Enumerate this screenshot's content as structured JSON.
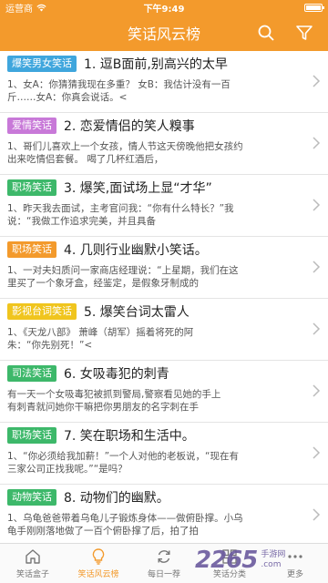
{
  "status": {
    "carrier": "运营商",
    "time": "下午9:49"
  },
  "header": {
    "title": "笑话风云榜"
  },
  "colors": {
    "accent": "#f39a2c"
  },
  "items": [
    {
      "tag": "爆笑男女笑话",
      "tag_color": "#3fa6dd",
      "title": "1. 逗B面前,别高兴的太早",
      "excerpt": "1、女A：你猜猜我现在多重？ 女B：我估计没有一百\n斤……女A：你真会说话。<"
    },
    {
      "tag": "爱情笑话",
      "tag_color": "#c879d8",
      "title": "2. 恋爱情侣的笑人糗事",
      "excerpt": "1、哥们儿喜欢上一个女孩，情人节这天傍晚他把女孩约\n出来吃情侣套餐。 喝了几杯红酒后，"
    },
    {
      "tag": "职场笑话",
      "tag_color": "#3db86a",
      "title": "3. 爆笑,面试场上显“才华”",
      "excerpt": "1、昨天我去面试，主考官问我：“你有什么特长？”我\n说：“我做工作追求完美，并且具备"
    },
    {
      "tag": "职场笑话",
      "tag_color": "#f39a2c",
      "title": "4. 几则行业幽默小笑话。",
      "excerpt": "1、一对夫妇质问一家商店经理说：“上星期，我们在这\n里买了一个象牙盒，经鉴定，是假象牙制成的"
    },
    {
      "tag": "影视台词笑话",
      "tag_color": "#f0c51e",
      "title": "5. 爆笑台词太雷人",
      "excerpt": "1、《天龙八部》      萧峰（胡军）摇着将死的阿\n朱：“你先别死！”<"
    },
    {
      "tag": "司法笑话",
      "tag_color": "#3db86a",
      "title": "6. 女吸毒犯的刺青",
      "excerpt": "    有一天一个女吸毒犯被抓到警局,警察看见她的手上\n有刺青就问她你干嘛把你男朋友的名字刺在手"
    },
    {
      "tag": "职场笑话",
      "tag_color": "#3db86a",
      "title": "7. 笑在职场和生活中。",
      "excerpt": "1、“你必须给我加薪！”一个人对他的老板说，“现在有\n三家公司正找我呢。”“是吗？"
    },
    {
      "tag": "动物笑话",
      "tag_color": "#3db86a",
      "title": "8. 动物们的幽默。",
      "excerpt": "1、乌龟爸爸带着乌龟儿子锻炼身体——做俯卧撑。小乌\n龟手刚刚落地做了一百个俯卧撑了后，拍了拍"
    }
  ],
  "tabs": [
    {
      "label": "笑话盒子",
      "icon": "home-icon",
      "active": false
    },
    {
      "label": "笑话风云榜",
      "icon": "lightbulb-icon",
      "active": true
    },
    {
      "label": "每日一荐",
      "icon": "refresh-icon",
      "active": false
    },
    {
      "label": "笑话分类",
      "icon": "grid-icon",
      "active": false
    },
    {
      "label": "更多",
      "icon": "more-icon",
      "active": false
    }
  ],
  "watermark": {
    "number": "2265",
    "sub1": "手游网",
    "sub2": ".com"
  }
}
